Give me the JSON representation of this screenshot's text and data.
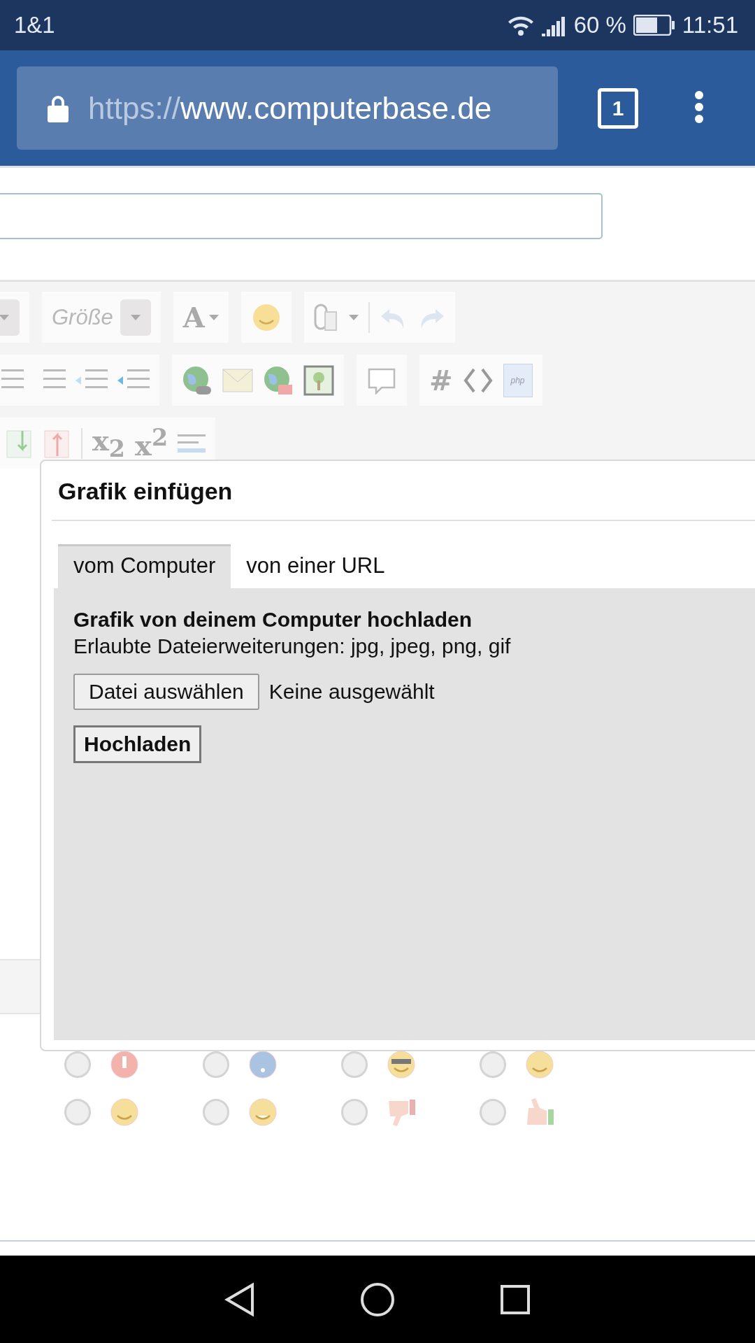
{
  "status_bar": {
    "carrier": "1&1",
    "battery": "60 %",
    "time": "11:51"
  },
  "browser": {
    "url_scheme": "https://",
    "url_host": "www.computerbase.de",
    "tab_count": "1"
  },
  "toolbar": {
    "size_dropdown": "Größe",
    "font_color_button": "A",
    "hashtag_button": "#",
    "php_icon": "php",
    "subscript_button": "x$_{2}$",
    "superscript_button": "x$^{2}$"
  },
  "dialog": {
    "title": "Grafik einfügen",
    "tabs": [
      {
        "label": "vom Computer",
        "selected": true
      },
      {
        "label": "von einer URL",
        "selected": false
      }
    ],
    "heading": "Grafik von deinem Computer hochladen",
    "allowed": "Erlaubte Dateierweiterungen: jpg, jpeg, png, gif",
    "file_button": "Datei auswählen",
    "file_status": "Keine ausgewählt",
    "upload_button": "Hochladen"
  },
  "smilies": [
    {
      "checked": false
    },
    {
      "checked": false
    },
    {
      "checked": false
    },
    {
      "checked": false
    },
    {
      "checked": false
    },
    {
      "checked": false
    },
    {
      "checked": false
    },
    {
      "checked": false
    }
  ]
}
